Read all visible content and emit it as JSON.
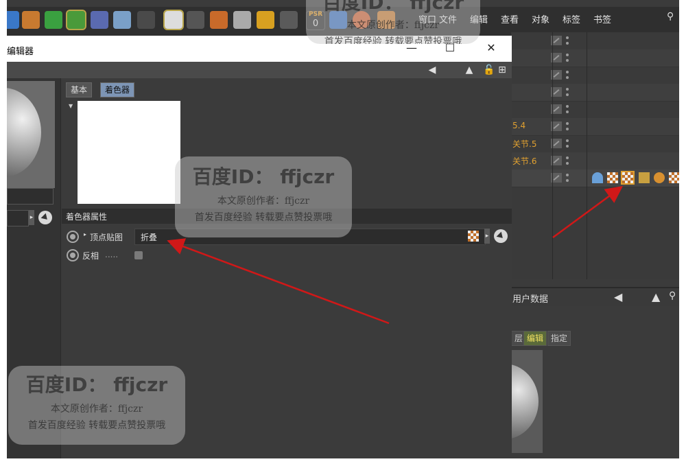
{
  "menubar": [
    "窗口",
    "文件",
    "编辑",
    "查看",
    "对象",
    "标签",
    "书签"
  ],
  "toolbar_icons": [
    "cube-icon",
    "pen-icon",
    "subdivision-icon",
    "array-icon",
    "deformer-icon",
    "floor-icon",
    "camera-icon",
    "light-icon",
    "figure-icon",
    "material-icon",
    "texture-tag-icon",
    "coordinate-icon",
    "joint-icon",
    "psr-icon",
    "move-icon",
    "scale-icon",
    "rotate-icon"
  ],
  "psr": {
    "label": "PSR",
    "value": "0"
  },
  "object_list": {
    "rows": [
      "",
      "",
      "",
      "",
      "",
      "5.4",
      "关节.5",
      "关节.6",
      ""
    ]
  },
  "editor": {
    "title": "编辑器",
    "tabs": [
      "基本",
      "着色器"
    ],
    "section_title": "着色器属性",
    "vertex_label": "顶点贴图",
    "vertex_value": "折叠",
    "invert_label": "反相",
    "invert_dots": "....."
  },
  "attributes": {
    "title": "用户数据",
    "buttons": [
      "层",
      "编辑",
      "指定"
    ]
  },
  "watermarks": [
    {
      "title": "百度ID： ffjczr",
      "line1": "本文原创作者：ffjczr",
      "line2": "首发百度经验 转载要点赞投票哦"
    },
    {
      "title": "百度ID： ffjczr",
      "line1": "本文原创作者：ffjczr",
      "line2": "首发百度经验 转载要点赞投票哦"
    },
    {
      "title": "百度ID： ffjczr",
      "line1": "本文原创作者：ffjczr",
      "line2": "首发百度经验 转载要点赞投票哦"
    }
  ],
  "colors": {
    "arrow": "#d01818",
    "active_tab": "#7d95b5",
    "highlight": "#e0a030"
  }
}
